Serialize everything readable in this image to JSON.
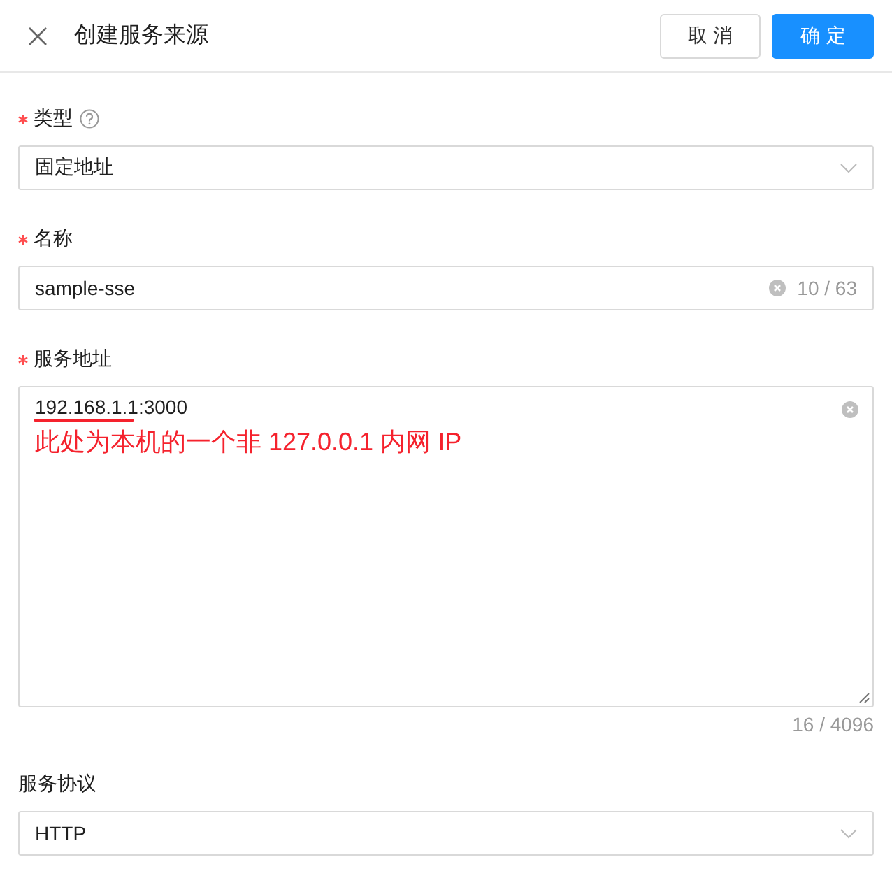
{
  "header": {
    "title": "创建服务来源",
    "buttons": [
      {
        "label": "取消",
        "kind": "default"
      },
      {
        "label": "确定",
        "kind": "primary"
      }
    ]
  },
  "fields": [
    {
      "kind": "select",
      "label": "类型",
      "required": true,
      "help": true,
      "value": "固定地址"
    },
    {
      "kind": "input",
      "label": "名称",
      "required": true,
      "help": false,
      "value": "sample-sse",
      "clearable": true,
      "count": "10 / 63"
    },
    {
      "kind": "textarea",
      "label": "服务地址",
      "required": true,
      "help": false,
      "value": "192.168.1.1:3000",
      "clearable": true,
      "count": "16 / 4096",
      "annotation": "此处为本机的一个非 127.0.0.1 内网 IP"
    },
    {
      "kind": "select",
      "label": "服务协议",
      "required": false,
      "help": false,
      "value": "HTTP"
    }
  ]
}
